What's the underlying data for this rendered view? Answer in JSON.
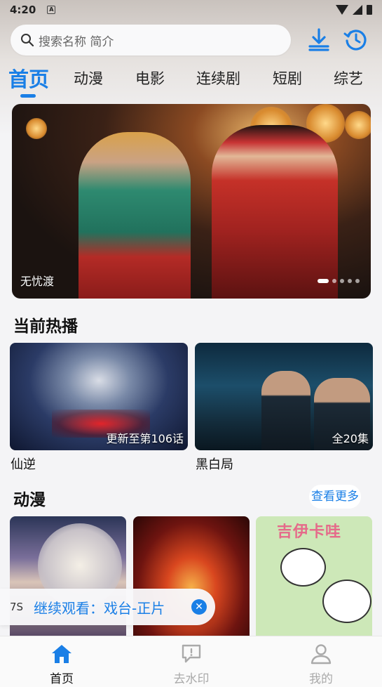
{
  "status_bar": {
    "time": "4:20",
    "notification_icon": "A"
  },
  "search": {
    "placeholder": "搜索名称 简介"
  },
  "header_icons": [
    "download-icon",
    "history-icon"
  ],
  "tabs": [
    {
      "label": "首页",
      "active": true
    },
    {
      "label": "动漫"
    },
    {
      "label": "电影"
    },
    {
      "label": "连续剧"
    },
    {
      "label": "短剧"
    },
    {
      "label": "综艺"
    }
  ],
  "banner": {
    "caption": "无忧渡",
    "slide_count": 5,
    "active_slide": 1
  },
  "hot": {
    "title": "当前热播",
    "items": [
      {
        "title": "仙逆",
        "tag": "更新至第106话"
      },
      {
        "title": "黑白局",
        "tag": "全20集"
      }
    ]
  },
  "anime": {
    "title": "动漫",
    "more_label": "查看更多",
    "card3_art_text": "吉伊卡哇"
  },
  "continue_watching": {
    "time": "7S",
    "label": "继续观看：戏台-正片"
  },
  "bottom_nav": [
    {
      "label": "首页",
      "active": true,
      "icon": "home-icon"
    },
    {
      "label": "去水印",
      "icon": "message-alert-icon"
    },
    {
      "label": "我的",
      "icon": "user-icon"
    }
  ],
  "colors": {
    "accent": "#1a7fe6"
  }
}
